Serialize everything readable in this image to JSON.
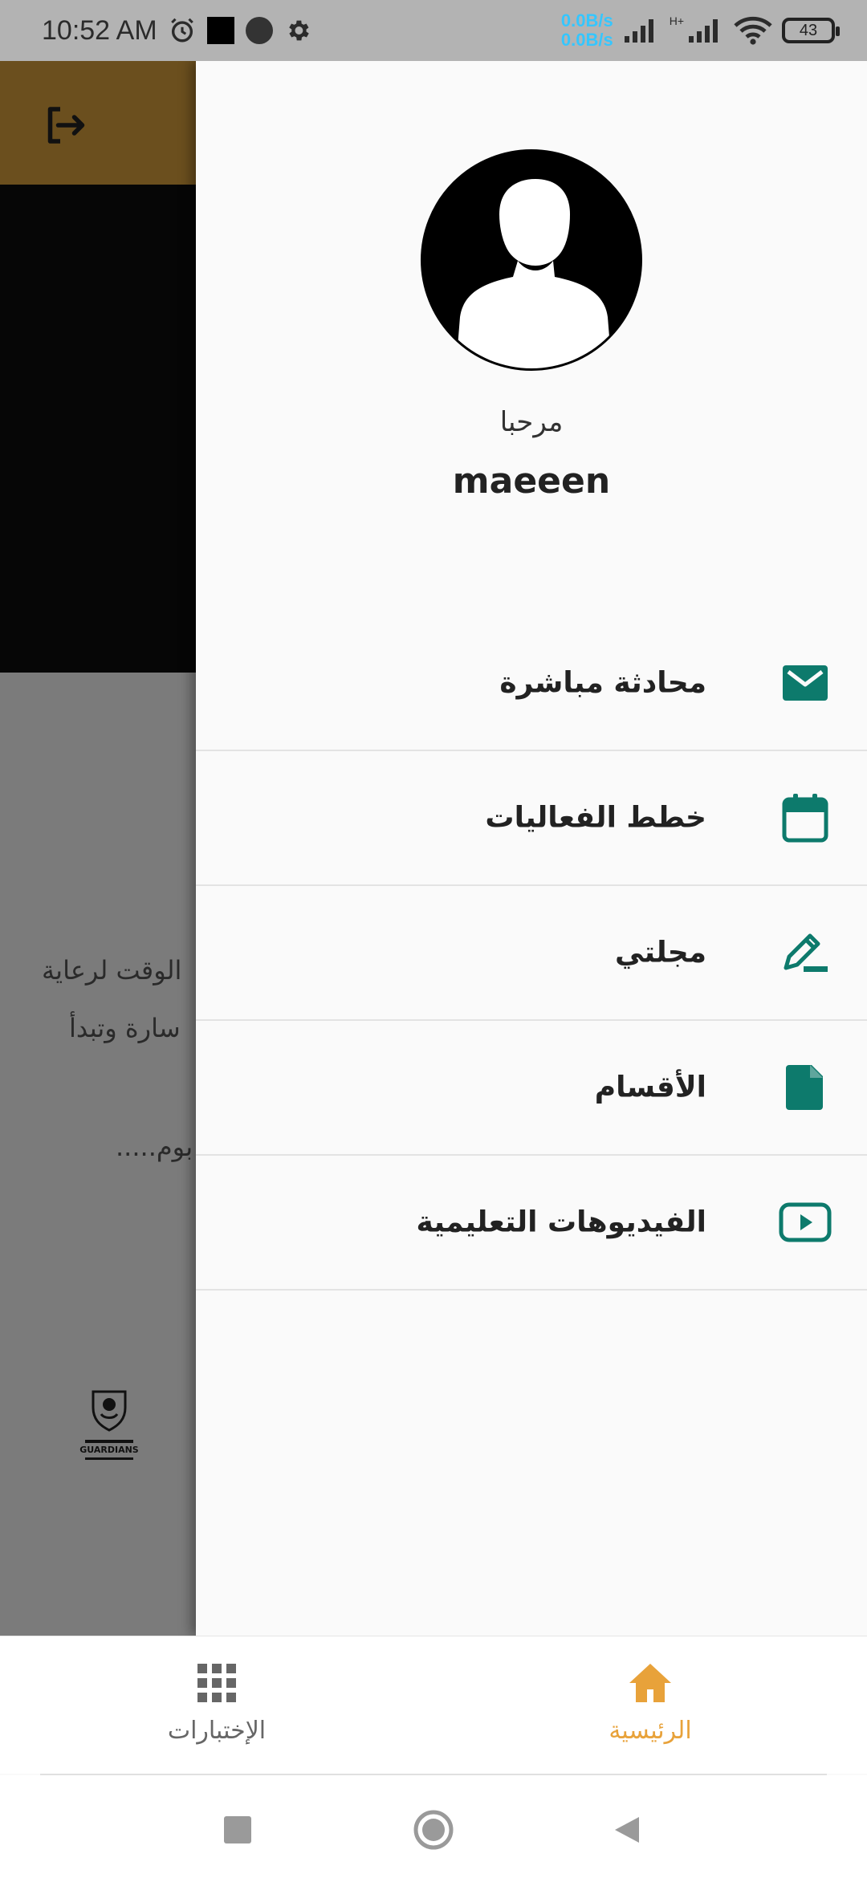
{
  "status_bar": {
    "time": "10:52 AM",
    "net_up": "0.0B/s",
    "net_down": "0.0B/s",
    "network_type": "H+",
    "battery": "43",
    "icons": [
      "alarm-icon",
      "notification-square-icon",
      "notification-dot-icon",
      "settings-icon",
      "signal-icon",
      "wifi-icon"
    ]
  },
  "background": {
    "header_color": "#6b4f1e",
    "paragraph_lines": [
      "الوقت لرعاية",
      "سارة وتبدأ",
      "بوم....."
    ],
    "logo_text": "GUARDIANS"
  },
  "drawer": {
    "greeting": "مرحبا",
    "username": "maeeen",
    "accent_color": "#0d7a6c",
    "menu": [
      {
        "label": "محادثة مباشرة",
        "icon": "mail-icon"
      },
      {
        "label": "خطط الفعاليات",
        "icon": "calendar-icon"
      },
      {
        "label": "مجلتي",
        "icon": "pencil-icon"
      },
      {
        "label": "الأقسام",
        "icon": "document-icon"
      },
      {
        "label": "الفيديوهات التعليمية",
        "icon": "video-play-icon"
      }
    ]
  },
  "bottom_nav": {
    "items": [
      {
        "label": "الإختبارات",
        "icon": "grid-icon",
        "active": false
      },
      {
        "label": "الرئيسية",
        "icon": "home-icon",
        "active": true
      }
    ],
    "active_color": "#e8a23a",
    "inactive_color": "#666666"
  },
  "system_nav": {
    "buttons": [
      "recents",
      "home",
      "back"
    ]
  }
}
